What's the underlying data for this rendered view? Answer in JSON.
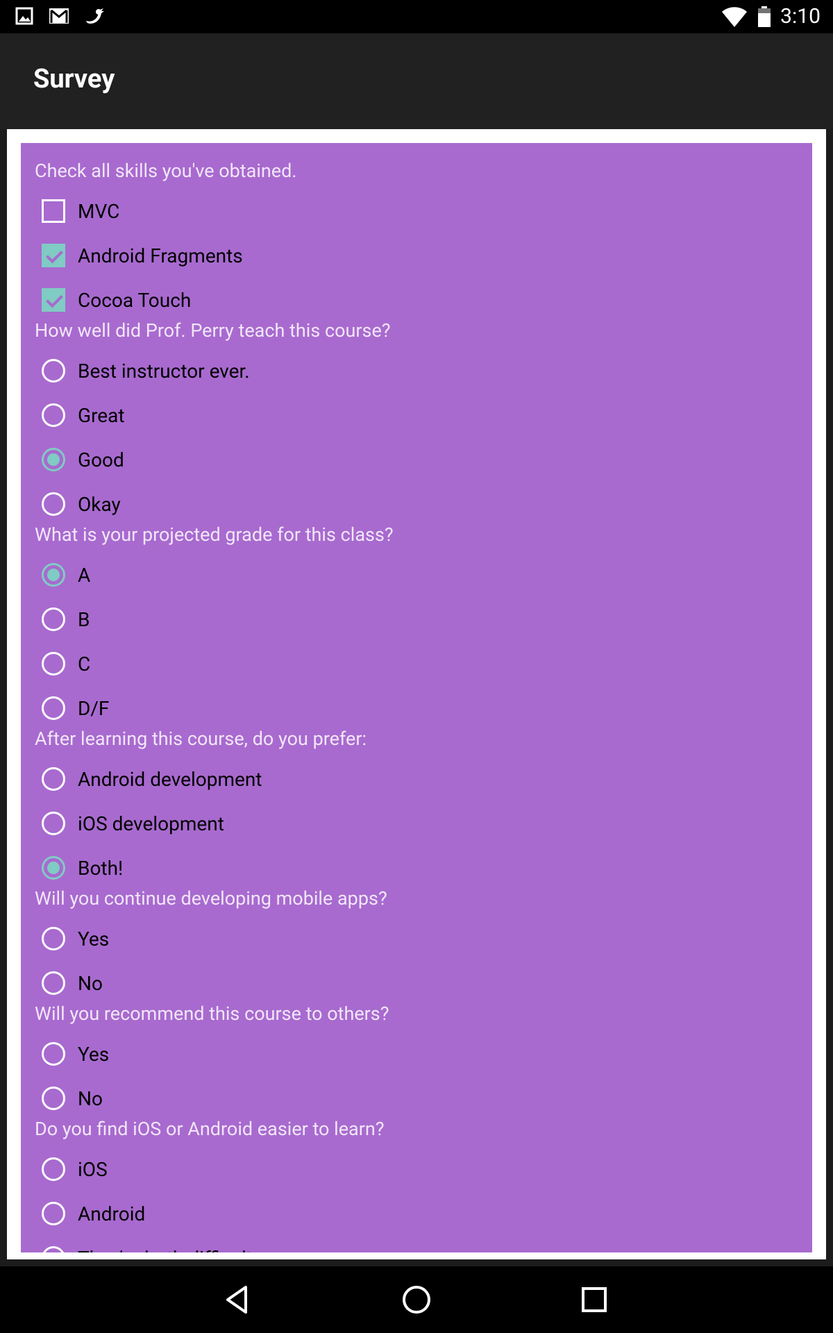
{
  "status_bar": {
    "icons": [
      "gallery-icon",
      "gmail-icon",
      "twitter-icon"
    ],
    "right_icons": [
      "wifi-icon",
      "battery-icon"
    ],
    "time": "3:10"
  },
  "app_bar": {
    "title": "Survey"
  },
  "colors": {
    "panel": "#a86acf",
    "accent": "#80cbc4",
    "appbar": "#212121"
  },
  "questions": [
    {
      "label": "Check all skills you've obtained.",
      "type": "checkbox",
      "options": [
        {
          "label": "MVC",
          "checked": false
        },
        {
          "label": "Android Fragments",
          "checked": true
        },
        {
          "label": "Cocoa Touch",
          "checked": true
        }
      ]
    },
    {
      "label": "How well did Prof. Perry teach this course?",
      "type": "radio",
      "options": [
        {
          "label": "Best instructor ever.",
          "checked": false
        },
        {
          "label": "Great",
          "checked": false
        },
        {
          "label": "Good",
          "checked": true
        },
        {
          "label": "Okay",
          "checked": false
        }
      ]
    },
    {
      "label": "What is your projected grade for this class?",
      "type": "radio",
      "options": [
        {
          "label": "A",
          "checked": true
        },
        {
          "label": "B",
          "checked": false
        },
        {
          "label": "C",
          "checked": false
        },
        {
          "label": "D/F",
          "checked": false
        }
      ]
    },
    {
      "label": "After learning this course, do you prefer:",
      "type": "radio",
      "options": [
        {
          "label": "Android development",
          "checked": false
        },
        {
          "label": "iOS development",
          "checked": false
        },
        {
          "label": "Both!",
          "checked": true
        }
      ]
    },
    {
      "label": "Will you continue developing mobile apps?",
      "type": "radio",
      "options": [
        {
          "label": "Yes",
          "checked": false
        },
        {
          "label": "No",
          "checked": false
        }
      ]
    },
    {
      "label": "Will you recommend this course to others?",
      "type": "radio",
      "options": [
        {
          "label": "Yes",
          "checked": false
        },
        {
          "label": "No",
          "checked": false
        }
      ]
    },
    {
      "label": "Do you find iOS or Android easier to learn?",
      "type": "radio",
      "options": [
        {
          "label": "iOS",
          "checked": false
        },
        {
          "label": "Android",
          "checked": false
        },
        {
          "label": "They're both difficult",
          "checked": false
        }
      ]
    }
  ],
  "nav_bar": {
    "buttons": [
      "back-icon",
      "home-icon",
      "recents-icon"
    ]
  }
}
